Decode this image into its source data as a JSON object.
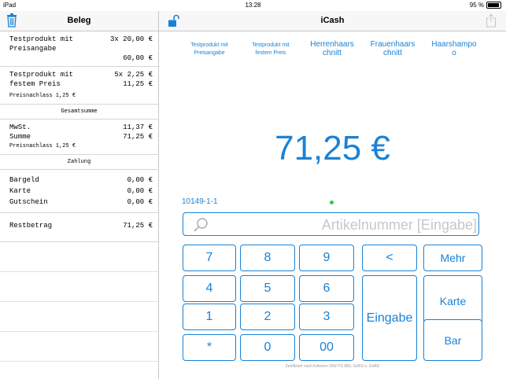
{
  "status": {
    "device": "iPad",
    "time": "13:28",
    "battery": "95 %"
  },
  "left": {
    "title": "Beleg",
    "items": [
      {
        "name": "Testprodukt mit\nPreisangabe",
        "qty": "3x 20,00 €",
        "total": "60,00 €",
        "discount": null
      },
      {
        "name": "Testprodukt mit\nfestem Preis",
        "qty": "5x 2,25 €",
        "total": "11,25 €",
        "discount": "Preisnachlass 1,25 €"
      }
    ],
    "gesamt": {
      "header": "Gesamtsumme",
      "mwst_label": "MwSt.",
      "mwst": "11,37 €",
      "summe_label": "Summe",
      "summe": "71,25 €",
      "discount": "Preisnachlass 1,25 €"
    },
    "zahlung": {
      "header": "Zahlung",
      "rows": [
        {
          "label": "Bargeld",
          "value": "0,00 €"
        },
        {
          "label": "Karte",
          "value": "0,00 €"
        },
        {
          "label": "Gutschein",
          "value": "0,00 €"
        }
      ]
    },
    "rest": {
      "label": "Restbetrag",
      "value": "71,25 €"
    }
  },
  "right": {
    "title": "iCash",
    "products": [
      "Testprodukt mit\nPreisangabe",
      "Testprodukt mit\nfestem Preis",
      "Herrenhaars\nchnitt",
      "Frauenhaars\nchnitt",
      "Haarshampo\no"
    ],
    "total": "71,25 €",
    "code": "10149-1-1",
    "search_placeholder": "Artikelnummer [Eingabe]",
    "keys": {
      "k7": "7",
      "k8": "8",
      "k9": "9",
      "k4": "4",
      "k5": "5",
      "k6": "6",
      "k1": "1",
      "k2": "2",
      "k3": "3",
      "kstar": "*",
      "k0": "0",
      "k00": "00",
      "back": "<",
      "mehr": "Mehr",
      "karte": "Karte",
      "eingabe": "Eingabe",
      "bar": "Bar"
    },
    "footer": "Zertifiziert nach Kriterien IDW PS 880, GoBS u. GoBD"
  },
  "colors": {
    "accent": "#1a82d6",
    "dot": "#2ecc40"
  }
}
